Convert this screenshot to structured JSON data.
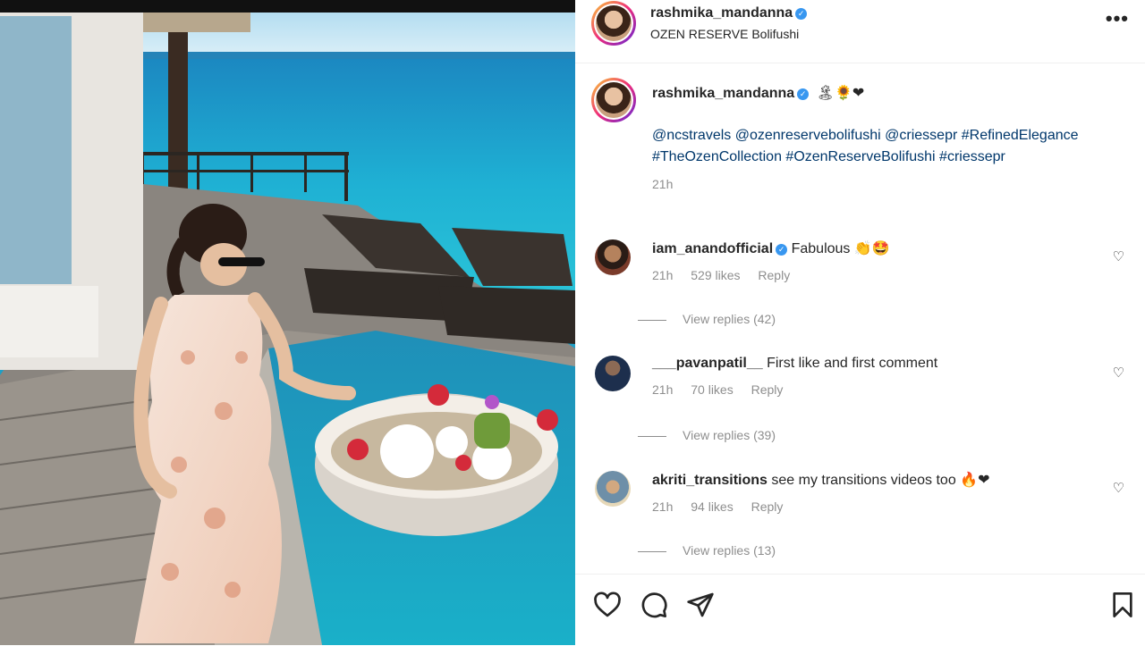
{
  "post": {
    "username": "rashmika_mandanna",
    "location": "OZEN RESERVE Bolifushi",
    "more_label": "•••",
    "caption_emojis": "🏝🌻❤",
    "caption_text": "@ncstravels @ozenreservebolifushi @criessepr #RefinedElegance #TheOzenCollection #OzenReserveBolifushi #criessepr",
    "caption_time": "21h"
  },
  "comments": [
    {
      "username": "iam_anandofficial",
      "text": "Fabulous 👏🤩",
      "time": "21h",
      "likes": "529 likes",
      "reply": "Reply",
      "view_replies": "View replies (42)",
      "verified": true
    },
    {
      "username": "___pavanpatil__",
      "text": "First like and first comment",
      "time": "21h",
      "likes": "70 likes",
      "reply": "Reply",
      "view_replies": "View replies (39)",
      "verified": false
    },
    {
      "username": "akriti_transitions",
      "text": "see my transitions videos too 🔥❤",
      "time": "21h",
      "likes": "94 likes",
      "reply": "Reply",
      "view_replies": "View replies (13)",
      "verified": false
    }
  ],
  "icons": {
    "like": "heart-icon",
    "comment": "comment-icon",
    "share": "share-icon",
    "save": "bookmark-icon",
    "verified": "verified-badge-icon"
  },
  "colors": {
    "verified": "#3897f0",
    "link": "#00376b",
    "muted": "#8e8e8e"
  }
}
